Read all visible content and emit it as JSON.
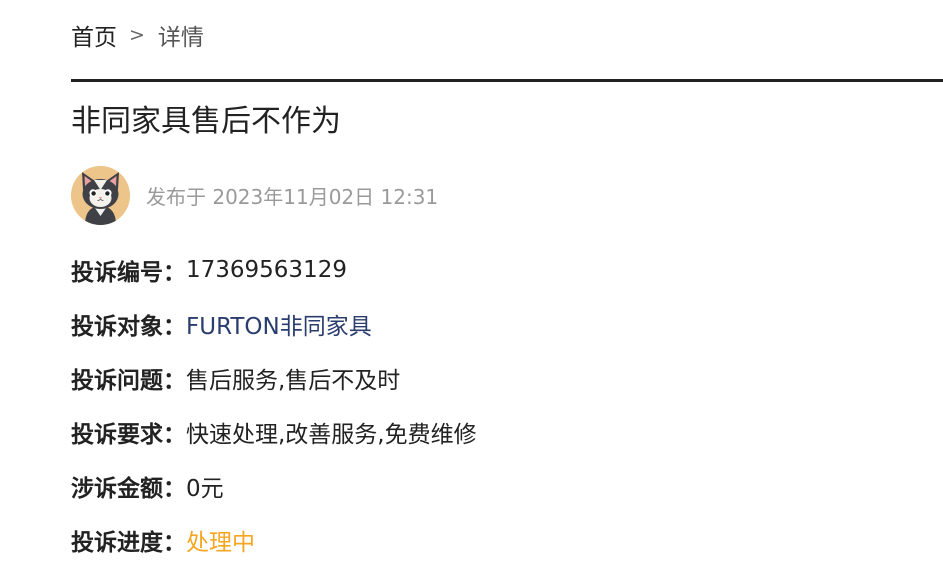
{
  "breadcrumb": {
    "home": "首页",
    "separator": ">",
    "current": "详情"
  },
  "article": {
    "title": "非同家具售后不作为",
    "published": "发布于 2023年11月02日 12:31",
    "avatar_icon": "cat-avatar-icon"
  },
  "fields": {
    "number_label": "投诉编号：",
    "number_value": "17369563129",
    "target_label": "投诉对象：",
    "target_value": "FURTON非同家具",
    "issue_label": "投诉问题：",
    "issue_value": "售后服务,售后不及时",
    "request_label": "投诉要求：",
    "request_value": "快速处理,改善服务,免费维修",
    "amount_label": "涉诉金额：",
    "amount_value": "0元",
    "progress_label": "投诉进度：",
    "progress_value": "处理中"
  },
  "colors": {
    "link": "#2a3d6e",
    "status": "#f5a623",
    "divider": "#222222",
    "meta_text": "#9a9a9a"
  }
}
